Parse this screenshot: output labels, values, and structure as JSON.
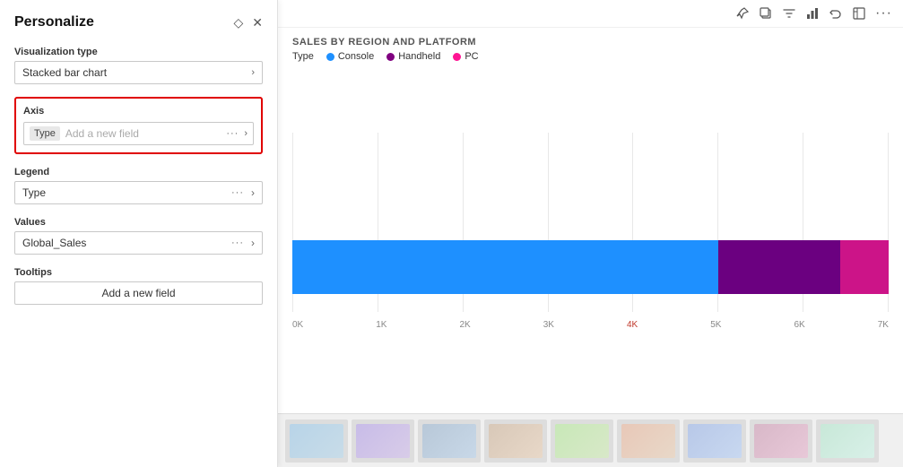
{
  "panel": {
    "title": "Personalize",
    "pin_icon": "◇",
    "close_icon": "✕"
  },
  "visualization": {
    "label": "Visualization type",
    "value": "Stacked bar chart"
  },
  "axis": {
    "label": "Axis",
    "type_tag": "Type",
    "placeholder": "Add a new field",
    "dots": "···",
    "chevron": "›"
  },
  "legend": {
    "label": "Legend",
    "value": "Type",
    "dots": "···",
    "chevron": "›"
  },
  "values": {
    "label": "Values",
    "value": "Global_Sales",
    "dots": "···",
    "chevron": "›"
  },
  "tooltips": {
    "label": "Tooltips",
    "add_label": "Add a new field"
  },
  "chart": {
    "title": "SALES BY REGION AND PLATFORM",
    "legend": [
      {
        "label": "Console",
        "color": "#1E90FF"
      },
      {
        "label": "Handheld",
        "color": "#800080"
      },
      {
        "label": "PC",
        "color": "#FF1493"
      }
    ],
    "toolbar_icons": [
      "📌",
      "□",
      "▽",
      "📊",
      "↩",
      "⊡",
      "···"
    ],
    "x_labels": [
      "0K",
      "1K",
      "2K",
      "3K",
      "4K",
      "5K",
      "6K",
      "7K"
    ],
    "bar_segments": [
      {
        "color": "#1E90FF",
        "flex": 70
      },
      {
        "color": "#6B0080",
        "flex": 20
      },
      {
        "color": "#CC1488",
        "flex": 8
      }
    ],
    "highlight_label_index": 4
  }
}
